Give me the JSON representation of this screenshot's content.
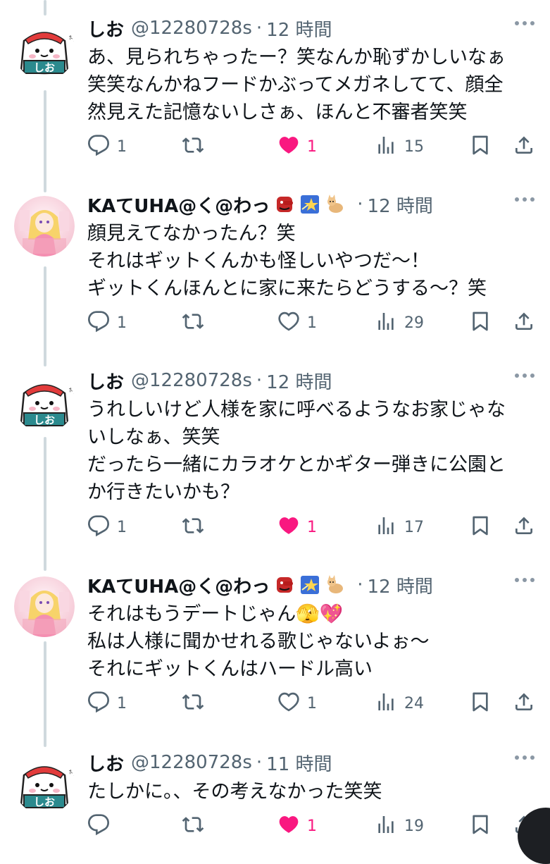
{
  "tweets": [
    {
      "name": "しお",
      "handle": "@12280728s",
      "sep": "·",
      "time": "12 時間",
      "text": "あ、見られちゃったー？笑なんか恥ずかしいなぁ\n笑笑なんかねフードかぶってメガネしてて、顔全\n然見えた記憶ないしさぁ、ほんと不審者笑笑",
      "avatar": "onigiri",
      "liked": true,
      "replies": "1",
      "likes": "1",
      "views": "15"
    },
    {
      "name": "KAてUHA@く@わっ",
      "handle": "",
      "sep": "·",
      "time": "12 時間",
      "text": "顔見えてなかったん？笑\nそれはギットくんかも怪しいやつだ〜！\nギットくんほんとに家に来たらどうする〜？笑",
      "avatar": "anime",
      "liked": false,
      "emojis": [
        "tengu-emoji",
        "star-emoji",
        "cat-emoji"
      ],
      "replies": "1",
      "likes": "1",
      "views": "29"
    },
    {
      "name": "しお",
      "handle": "@12280728s",
      "sep": "·",
      "time": "12 時間",
      "text": "うれしいけど人様を家に呼べるようなお家じゃな\nいしなぁ、笑笑\nだったら一緒にカラオケとかギター弾きに公園と\nか行きたいかも？",
      "avatar": "onigiri",
      "liked": true,
      "replies": "1",
      "likes": "1",
      "views": "17"
    },
    {
      "name": "KAてUHA@く@わっ",
      "handle": "",
      "sep": "·",
      "time": "12 時間",
      "text": "それはもうデートじゃん🫣💖\n私は人様に聞かせれる歌じゃないよぉ〜\nそれにギットくんはハードル高い",
      "avatar": "anime",
      "liked": false,
      "emojis": [
        "tengu-emoji",
        "star-emoji",
        "cat-emoji"
      ],
      "replies": "1",
      "likes": "1",
      "views": "24"
    },
    {
      "name": "しお",
      "handle": "@12280728s",
      "sep": "·",
      "time": "11 時間",
      "text": "たしかに。、その考えなかった笑笑",
      "avatar": "onigiri",
      "liked": true,
      "replies": "",
      "likes": "1",
      "views": "19"
    }
  ],
  "avatar_text": {
    "onigiri_label": "しお",
    "onigiri_small": "やあ!"
  },
  "colors": {
    "like": "#f91880",
    "icon": "#536471",
    "thread": "#cfd9de"
  }
}
